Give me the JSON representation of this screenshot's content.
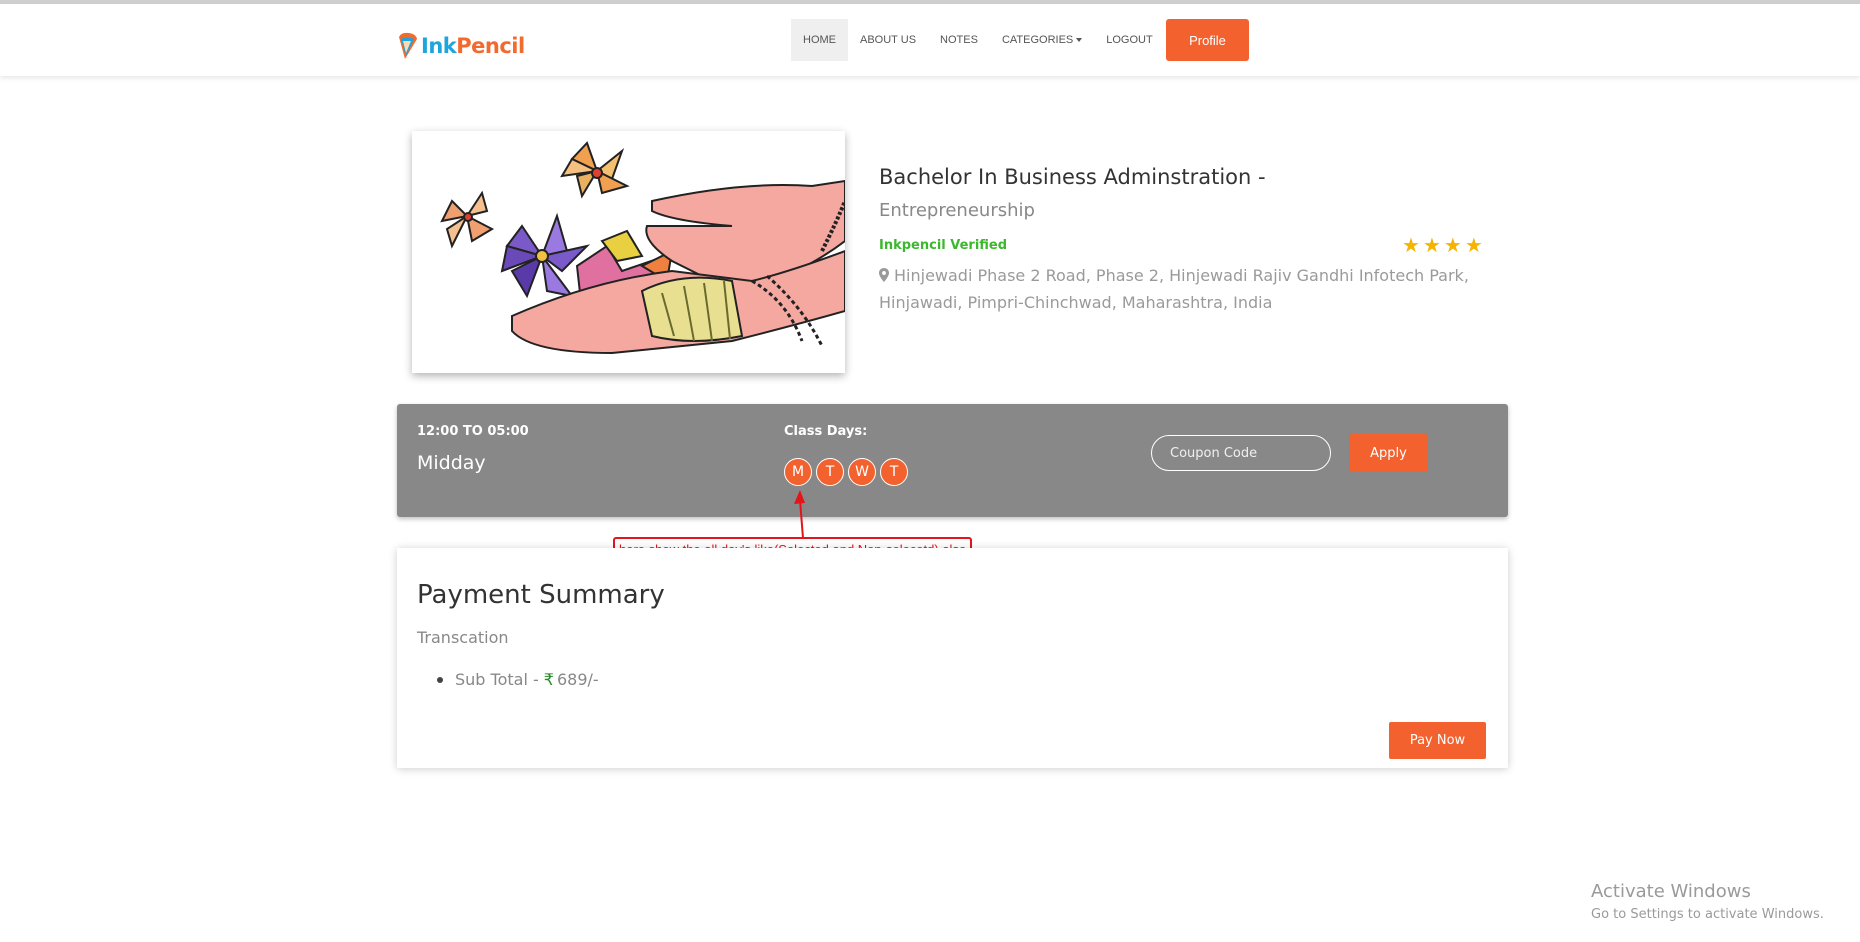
{
  "brand": {
    "part1": "Ink",
    "part2": "Pencil"
  },
  "nav": {
    "items": [
      {
        "label": "HOME"
      },
      {
        "label": "ABOUT US"
      },
      {
        "label": "NOTES"
      },
      {
        "label": "CATEGORIES"
      },
      {
        "label": "LOGOUT"
      }
    ],
    "profile_label": "Profile"
  },
  "course": {
    "title": "Bachelor In Business Adminstration -",
    "subtitle": "Entrepreneurship",
    "verified": "Inkpencil Verified",
    "rating": 4,
    "address_line1": "Hinjewadi Phase 2 Road, Phase 2, Hinjewadi Rajiv Gandhi Infotech Park,",
    "address_line2": "Hinjawadi, Pimpri-Chinchwad, Maharashtra, India"
  },
  "schedule": {
    "time_range": "12:00 TO 05:00",
    "period": "Midday",
    "days_label": "Class Days:",
    "days": [
      "M",
      "T",
      "W",
      "T"
    ],
    "coupon_placeholder": "Coupon Code",
    "apply_label": "Apply"
  },
  "annotation": {
    "text": "here show the all day's like(Selected and Non-selecetd) also"
  },
  "payment": {
    "title": "Payment Summary",
    "subtitle": "Transcation",
    "subtotal_label": "Sub Total -",
    "currency_symbol": "₹",
    "subtotal_value": "689/-",
    "pay_now_label": "Pay Now"
  },
  "watermark": {
    "title": "Activate Windows",
    "subtitle": "Go to Settings to activate Windows."
  },
  "colors": {
    "accent": "#f2612e",
    "schedule_bg": "#888888",
    "verified": "#3cb72e",
    "star": "#f4b400",
    "annotation": "#e4141b"
  }
}
